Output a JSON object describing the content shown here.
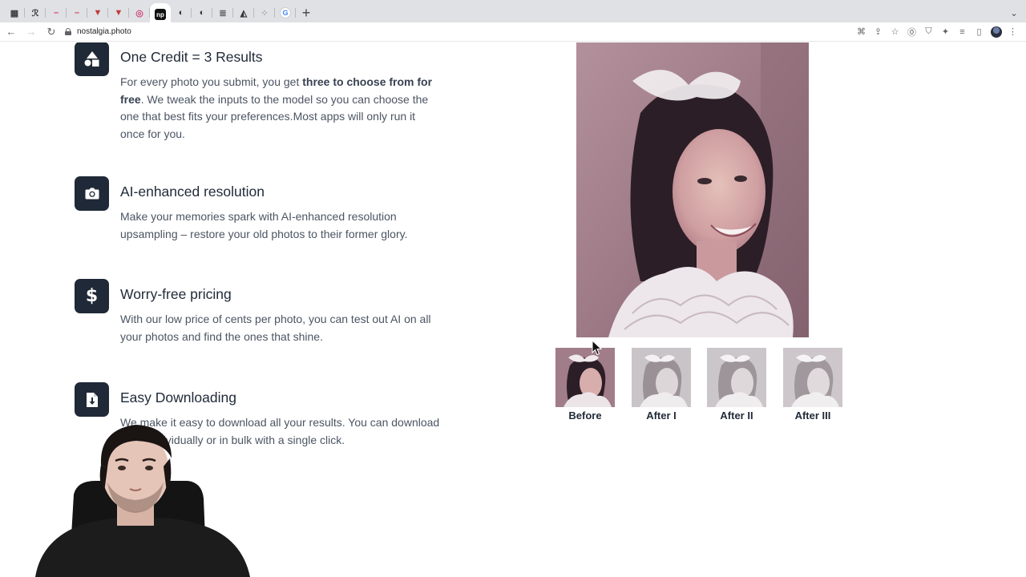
{
  "browser": {
    "tabs": [
      {
        "icon": "app-grid-icon",
        "color": "#3c4043",
        "glyph": "▦"
      },
      {
        "icon": "script-icon",
        "color": "#3c4043",
        "glyph": "ℛ"
      },
      {
        "icon": "record-icon",
        "color": "#e33b5b",
        "glyph": "–"
      },
      {
        "icon": "record-icon",
        "color": "#e33b5b",
        "glyph": "–"
      },
      {
        "icon": "vee-icon",
        "color": "#c03b3b",
        "glyph": "▼"
      },
      {
        "icon": "vee-icon",
        "color": "#c03b3b",
        "glyph": "▼"
      },
      {
        "icon": "openai-icon",
        "color": "#d04a7a",
        "glyph": "◎"
      },
      {
        "icon": "np-icon",
        "color": "#111111",
        "glyph": "np",
        "active": true
      },
      {
        "icon": "light-icon",
        "color": "#333333",
        "glyph": "◐"
      },
      {
        "icon": "light-icon",
        "color": "#333333",
        "glyph": "◐"
      },
      {
        "icon": "doc-icon",
        "color": "#6b6b6b",
        "glyph": "≣"
      },
      {
        "icon": "android-icon",
        "color": "#333333",
        "glyph": "◭"
      },
      {
        "icon": "spinner-icon",
        "color": "#9aa0a6",
        "glyph": "⁘"
      },
      {
        "icon": "google-icon",
        "color": "#ffffff",
        "glyph": "G"
      }
    ],
    "url": "nostalgia.photo"
  },
  "features": [
    {
      "title": "One Credit = 3 Results",
      "desc_before": "For every photo you submit, you get ",
      "desc_bold": "three to choose from for free",
      "desc_after": ". We tweak the inputs to the model so you can choose the one that best fits your preferences.Most apps will only run it once for you.",
      "icon": "shapes-icon"
    },
    {
      "title": "AI-enhanced resolution",
      "desc": "Make your memories spark with AI-enhanced resolution upsampling – restore your old photos to their former glory.",
      "icon": "camera-icon"
    },
    {
      "title": "Worry-free pricing",
      "desc": "With our low price of cents per photo, you can test out AI on all your photos and find the ones that shine.",
      "icon": "dollar-icon",
      "glyph": "$"
    },
    {
      "title": "Easy Downloading",
      "desc": "We make it easy to download all your results. You can download them individually or in bulk with a single click.",
      "icon": "file-download-icon"
    }
  ],
  "gallery": {
    "thumbnails": [
      {
        "label": "Before"
      },
      {
        "label": "After I"
      },
      {
        "label": "After II"
      },
      {
        "label": "After III"
      }
    ]
  },
  "colors": {
    "icon_bg": "#1f2937",
    "heading": "#1f2937",
    "body_text": "#4b5563"
  }
}
